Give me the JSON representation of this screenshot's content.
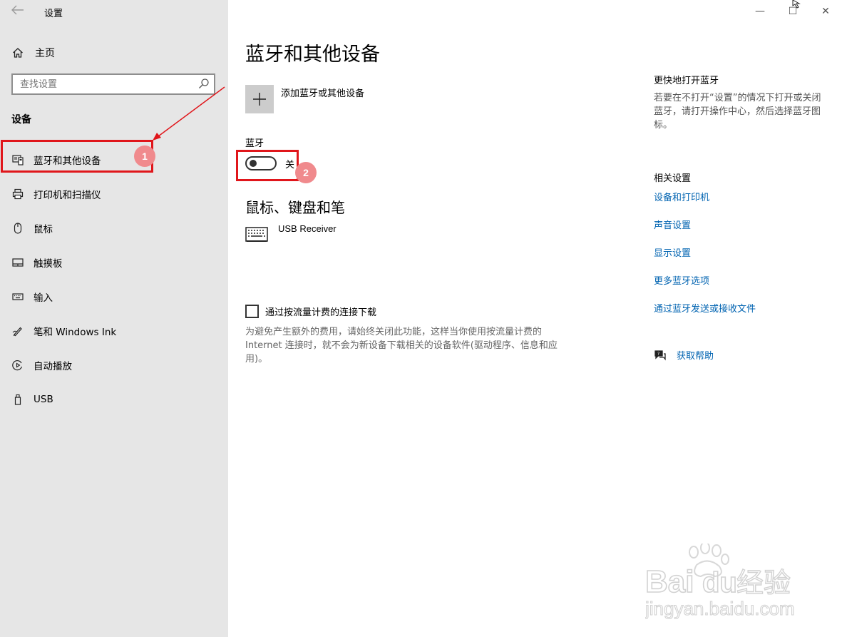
{
  "window": {
    "title": "设置",
    "controls": [
      "—",
      "☐",
      "✕"
    ]
  },
  "sidebar": {
    "home_label": "主页",
    "search_placeholder": "查找设置",
    "section_label": "设备",
    "items": [
      {
        "label": "蓝牙和其他设备",
        "icon": "bluetooth-devices-icon"
      },
      {
        "label": "打印机和扫描仪",
        "icon": "printer-icon"
      },
      {
        "label": "鼠标",
        "icon": "mouse-icon"
      },
      {
        "label": "触摸板",
        "icon": "touchpad-icon"
      },
      {
        "label": "输入",
        "icon": "keyboard-icon"
      },
      {
        "label": "笔和 Windows Ink",
        "icon": "pen-icon"
      },
      {
        "label": "自动播放",
        "icon": "autoplay-icon"
      },
      {
        "label": "USB",
        "icon": "usb-icon"
      }
    ]
  },
  "main": {
    "title": "蓝牙和其他设备",
    "add_device_label": "添加蓝牙或其他设备",
    "bluetooth_label": "蓝牙",
    "bluetooth_state": "关",
    "bluetooth_on": false,
    "peripherals_title": "鼠标、键盘和笔",
    "devices": [
      {
        "name": "USB Receiver",
        "icon": "keyboard-icon"
      }
    ],
    "metered_label": "通过按流量计费的连接下载",
    "metered_checked": false,
    "metered_desc": "为避免产生额外的费用，请始终关闭此功能，这样当你使用按流量计费的Internet 连接时，就不会为新设备下载相关的设备软件(驱动程序、信息和应用)。"
  },
  "side_panel": {
    "quick_title": "更快地打开蓝牙",
    "quick_desc": "若要在不打开“设置”的情况下打开或关闭蓝牙，请打开操作中心，然后选择蓝牙图标。",
    "related_title": "相关设置",
    "links": [
      "设备和打印机",
      "声音设置",
      "显示设置",
      "更多蓝牙选项",
      "通过蓝牙发送或接收文件"
    ],
    "help_label": "获取帮助"
  },
  "annotations": {
    "badge1": "1",
    "badge2": "2",
    "color": "#e0161b"
  },
  "watermark": {
    "brand": "Bai",
    "brand2": "du",
    "brand_cn": "经验",
    "url": "jingyan.baidu.com"
  }
}
